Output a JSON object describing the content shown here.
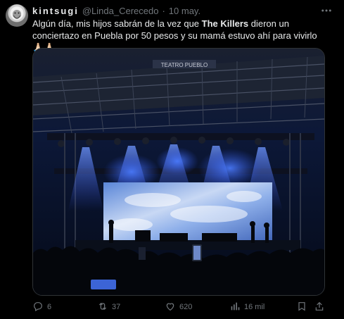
{
  "tweet": {
    "display_name": "kintsugi",
    "handle": "@Linda_Cerecedo",
    "separator": "·",
    "date": "10 may.",
    "text_before": "Algún día, mis hijos sabrán de la vez que ",
    "text_bold": "The Killers",
    "text_after": " dieron un conciertazo en Puebla por 50 pesos y su mamá estuvo ahí para vivirlo 🙏🏻🙏🏻",
    "stage_sign": "TEATRO   PUEBLO"
  },
  "actions": {
    "replies": "6",
    "retweets": "37",
    "likes": "620",
    "views": "16 mil"
  },
  "colors": {
    "background": "#000000",
    "text": "#e7e9ea",
    "muted": "#71767b",
    "stage_blue": "#3a6cff"
  },
  "icons": [
    "reply-icon",
    "retweet-icon",
    "like-icon",
    "views-icon",
    "bookmark-icon",
    "share-icon",
    "more-icon"
  ]
}
